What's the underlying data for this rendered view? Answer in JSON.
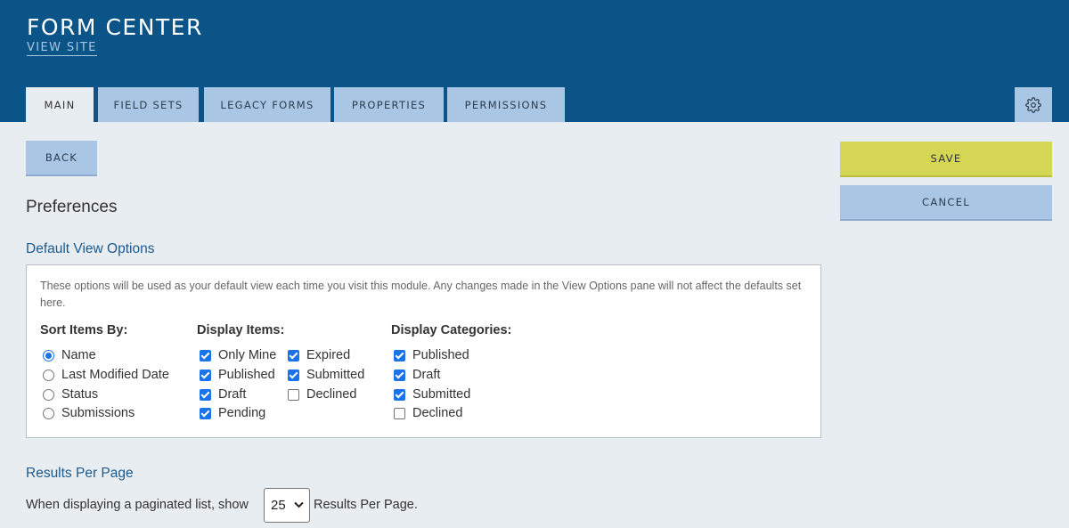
{
  "header": {
    "title": "FORM CENTER",
    "view_site": "VIEW SITE",
    "background_color": "#0b5487"
  },
  "tabs": [
    {
      "label": "MAIN",
      "active": true
    },
    {
      "label": "FIELD SETS",
      "active": false
    },
    {
      "label": "LEGACY FORMS",
      "active": false
    },
    {
      "label": "PROPERTIES",
      "active": false
    },
    {
      "label": "PERMISSIONS",
      "active": false
    }
  ],
  "settings_icon": "gear-icon",
  "buttons": {
    "back": "BACK",
    "save": "SAVE",
    "cancel": "CANCEL"
  },
  "colors": {
    "tab": "#a9c6e5",
    "save": "#d4d654",
    "heading_accent": "#1b5a8e"
  },
  "preferences": {
    "title": "Preferences",
    "default_view": {
      "title": "Default View Options",
      "note": "These options will be used as your default view each time you visit this module. Any changes made in the View Options pane will not affect the defaults set here.",
      "sort_by": {
        "title": "Sort Items By:",
        "options": [
          {
            "label": "Name",
            "selected": true
          },
          {
            "label": "Last Modified Date",
            "selected": false
          },
          {
            "label": "Status",
            "selected": false
          },
          {
            "label": "Submissions",
            "selected": false
          }
        ]
      },
      "display_items": {
        "title": "Display Items:",
        "options": [
          {
            "label": "Only Mine",
            "checked": true
          },
          {
            "label": "Published",
            "checked": true
          },
          {
            "label": "Draft",
            "checked": true
          },
          {
            "label": "Pending",
            "checked": true
          },
          {
            "label": "Expired",
            "checked": true
          },
          {
            "label": "Submitted",
            "checked": true
          },
          {
            "label": "Declined",
            "checked": false
          }
        ]
      },
      "display_categories": {
        "title": "Display Categories:",
        "options": [
          {
            "label": "Published",
            "checked": true
          },
          {
            "label": "Draft",
            "checked": true
          },
          {
            "label": "Submitted",
            "checked": true
          },
          {
            "label": "Declined",
            "checked": false
          }
        ]
      }
    },
    "results_per_page": {
      "title": "Results Per Page",
      "prefix": "When displaying a paginated list, show",
      "value": "25",
      "suffix": "Results Per Page."
    }
  }
}
